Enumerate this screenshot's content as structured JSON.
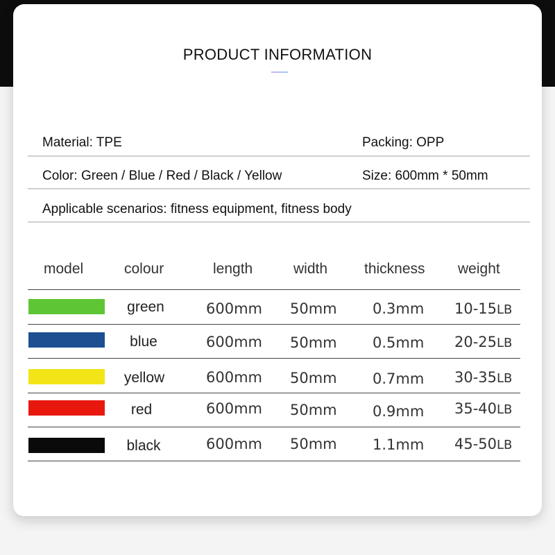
{
  "title": "PRODUCT INFORMATION",
  "info": {
    "material": "Material: TPE",
    "packing": "Packing: OPP",
    "color": "Color: Green / Blue / Red / Black / Yellow",
    "size": "Size: 600mm * 50mm",
    "scenarios": "Applicable scenarios: fitness equipment, fitness body"
  },
  "table": {
    "headers": [
      "model",
      "colour",
      "length",
      "width",
      "thickness",
      "weight"
    ],
    "rows": [
      {
        "swatch": "#5ec634",
        "colour": "green",
        "length": "600mm",
        "width": "50mm",
        "thickness": "0.3mm",
        "weight": "10-15",
        "unit": "LB"
      },
      {
        "swatch": "#1d4f91",
        "colour": "blue",
        "length": "600mm",
        "width": "50mm",
        "thickness": "0.5mm",
        "weight": "20-25",
        "unit": "LB"
      },
      {
        "swatch": "#f3e417",
        "colour": "yellow",
        "length": "600mm",
        "width": "50mm",
        "thickness": "0.7mm",
        "weight": "30-35",
        "unit": "LB"
      },
      {
        "swatch": "#e8180f",
        "colour": "red",
        "length": "600mm",
        "width": "50mm",
        "thickness": "0.9mm",
        "weight": "35-40",
        "unit": "LB"
      },
      {
        "swatch": "#0a0a0a",
        "colour": "black",
        "length": "600mm",
        "width": "50mm",
        "thickness": "1.1mm",
        "weight": "45-50",
        "unit": "LB"
      }
    ]
  }
}
